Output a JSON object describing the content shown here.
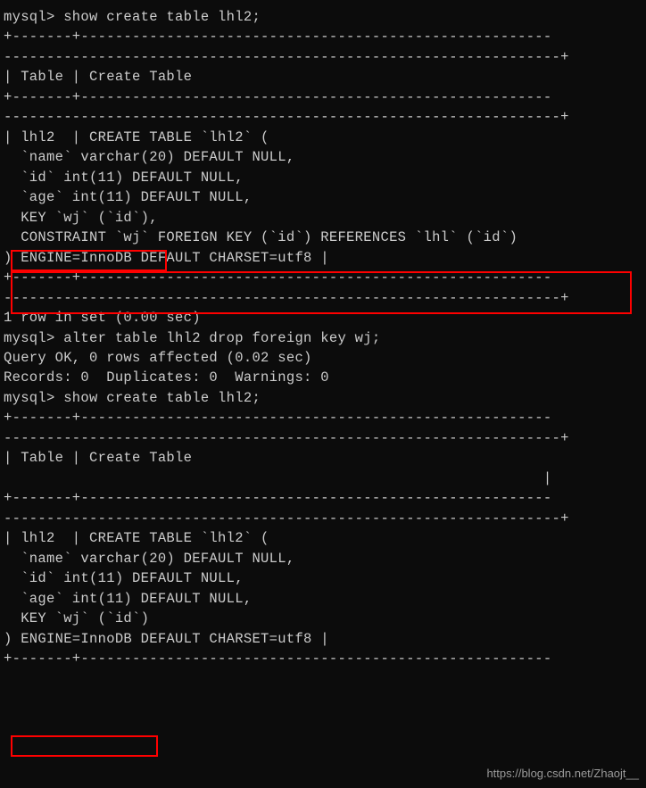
{
  "lines": {
    "l1": "mysql> show create table lhl2;",
    "l2": "+-------+-------------------------------------------------------",
    "l3": "| Table | Create Table",
    "l4": "",
    "l5": "+-------+-------------------------------------------------------",
    "l6": "| lhl2  | CREATE TABLE `lhl2` (",
    "l7": "  `name` varchar(20) DEFAULT NULL,",
    "l8": "  `id` int(11) DEFAULT NULL,",
    "l9": "  `age` int(11) DEFAULT NULL,",
    "l10": "  KEY `wj` (`id`),",
    "l11": "  CONSTRAINT `wj` FOREIGN KEY (`id`) REFERENCES `lhl` (`id`)",
    "l12": ") ENGINE=InnoDB DEFAULT CHARSET=utf8 |",
    "l13": "+-------+-------------------------------------------------------",
    "l14": "1 row in set (0.00 sec)",
    "l15": "",
    "l16": "mysql> alter table lhl2 drop foreign key wj;",
    "l17": "Query OK, 0 rows affected (0.02 sec)",
    "l18": "Records: 0  Duplicates: 0  Warnings: 0",
    "l19": "",
    "l20": "mysql> show create table lhl2;",
    "l21": "+-------+-------------------------------------------------------",
    "l22": "",
    "l23": "| Table | Create Table",
    "l24": "                                                               |",
    "l25": "+-------+-------------------------------------------------------",
    "l26": "",
    "l27": "| lhl2  | CREATE TABLE `lhl2` (",
    "l28": "  `name` varchar(20) DEFAULT NULL,",
    "l29": "  `id` int(11) DEFAULT NULL,",
    "l30": "  `age` int(11) DEFAULT NULL,",
    "l31": "  KEY `wj` (`id`)",
    "l32": ") ENGINE=InnoDB DEFAULT CHARSET=utf8 |"
  },
  "watermark": "https://blog.csdn.net/Zhaojt__"
}
